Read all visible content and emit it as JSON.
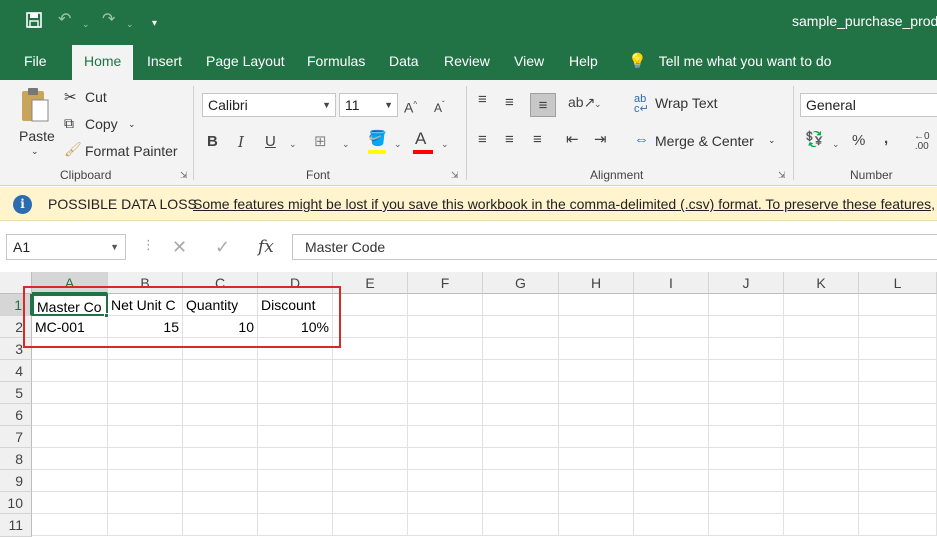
{
  "title_bar": {
    "doc_title": "sample_purchase_produ",
    "quick_access": [
      "save-icon",
      "undo-icon",
      "redo-icon",
      "customize-icon"
    ]
  },
  "tabs": [
    "File",
    "Home",
    "Insert",
    "Page Layout",
    "Formulas",
    "Data",
    "Review",
    "View",
    "Help"
  ],
  "active_tab": "Home",
  "tell_me": "Tell me what you want to do",
  "ribbon": {
    "clipboard": {
      "paste": "Paste",
      "cut": "Cut",
      "copy": "Copy",
      "format_painter": "Format Painter",
      "label": "Clipboard"
    },
    "font": {
      "name": "Calibri",
      "size": "11",
      "bold": "B",
      "italic": "I",
      "underline": "U",
      "font_color_glyph": "A",
      "label": "Font"
    },
    "alignment": {
      "wrap_text": "Wrap Text",
      "merge_center": "Merge & Center",
      "label": "Alignment"
    },
    "number": {
      "format": "General",
      "percent": "%",
      "comma": ",",
      "label": "Number"
    }
  },
  "notification": {
    "heading": "POSSIBLE DATA LOSS",
    "message": "Some features might be lost if you save this workbook in the comma-delimited (.csv) format. To preserve these features,"
  },
  "formula_bar": {
    "name_box": "A1",
    "content": "Master Code"
  },
  "grid": {
    "columns": [
      "A",
      "B",
      "C",
      "D",
      "E",
      "F",
      "G",
      "H",
      "I",
      "J",
      "K",
      "L"
    ],
    "rows": [
      "1",
      "2",
      "3",
      "4",
      "5",
      "6",
      "7",
      "8",
      "9",
      "10",
      "11"
    ],
    "cells": {
      "A1": "Master Co",
      "B1": "Net Unit C",
      "C1": "Quantity",
      "D1": "Discount",
      "A2": "MC-001",
      "B2": "15",
      "C2": "10",
      "D2": "10%"
    }
  },
  "colors": {
    "excel_green": "#217346",
    "highlight_red": "#d62a2a",
    "notice_yellow": "#fff4ce"
  }
}
